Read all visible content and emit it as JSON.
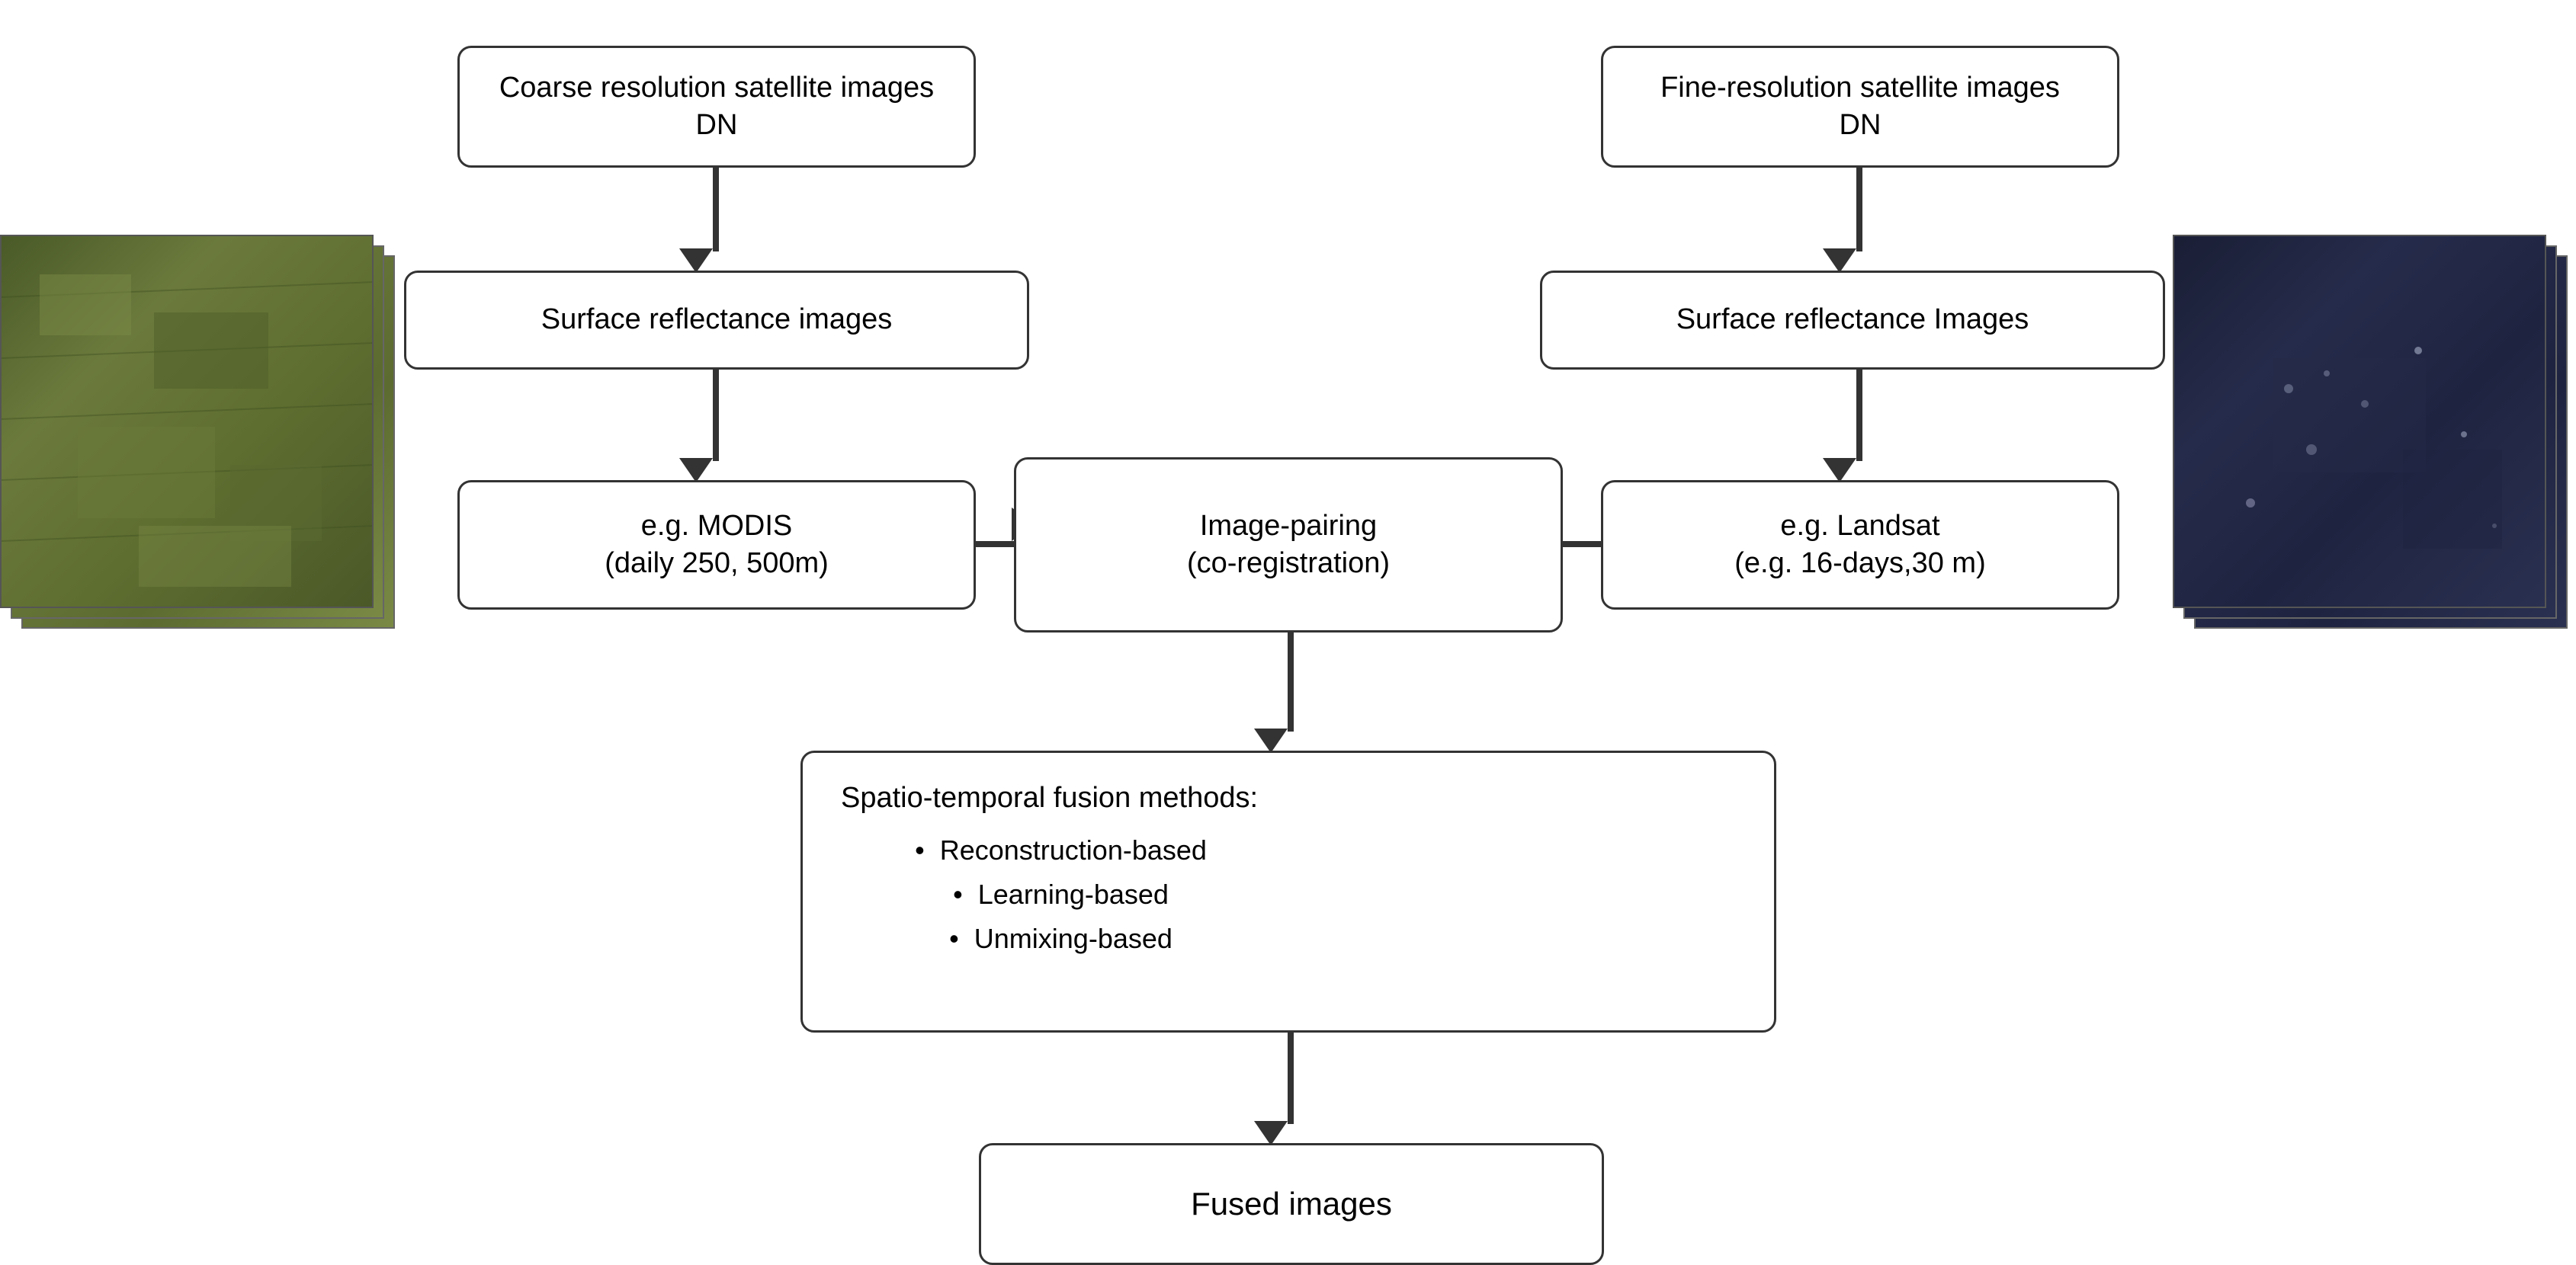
{
  "boxes": {
    "coarse_title": "Coarse resolution satellite images\nDN",
    "fine_title": "Fine-resolution satellite images\nDN",
    "coarse_surface": "Surface reflectance images",
    "fine_surface": "Surface reflectance Images",
    "modis_label": "e.g. MODIS\n(daily 250, 500m)",
    "image_pairing": "Image-pairing\n(co-registration)",
    "landsat_label": "e.g. Landsat\n(e.g. 16-days,30 m)",
    "fusion_methods_title": "Spatio-temporal fusion methods:",
    "fusion_bullet1": "Reconstruction-based",
    "fusion_bullet2": "Learning-based",
    "fusion_bullet3": "Unmixing-based",
    "fused_images": "Fused images"
  }
}
